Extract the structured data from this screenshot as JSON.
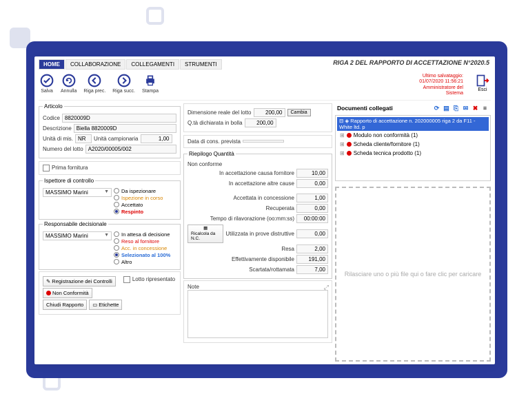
{
  "tabs": {
    "home": "HOME",
    "collab": "COLLABORAZIONE",
    "colleg": "COLLEGAMENTI",
    "strum": "STRUMENTI"
  },
  "title": "RIGA 2 DEL RAPPORTO DI ACCETTAZIONE N°2020.5",
  "toolbar": {
    "salva": "Salva",
    "annulla": "Annulla",
    "riga_prec": "Riga prec.",
    "riga_succ": "Riga succ.",
    "stampa": "Stampa",
    "esci": "Esci"
  },
  "saveinfo": {
    "line1": "Ultimo salvataggio:",
    "line2": "01/07/2020 11:56:21",
    "line3": "Amministratore del",
    "line4": "Sistema"
  },
  "articolo": {
    "legend": "Articolo",
    "codice_lbl": "Codice",
    "codice": "8820009D",
    "descr_lbl": "Descrizione",
    "descr": "Biella 8820009D",
    "um_lbl": "Unità di mis.",
    "um": "NR",
    "ucamp_lbl": "Unità campionaria",
    "ucamp": "1,00",
    "lotto_lbl": "Numero del lotto",
    "lotto": "A2020/00005/002",
    "prima_lbl": "Prima fornitura"
  },
  "ispettore": {
    "legend": "Ispettore di controllo",
    "value": "MASSIMO Marini",
    "r1": "Da ispezionare",
    "r2": "Ispezione in corso",
    "r3": "Accettato",
    "r4": "Respinto"
  },
  "responsabile": {
    "legend": "Responsabile decisionale",
    "value": "MASSIMO Marini",
    "r1": "In attesa di decisione",
    "r2": "Reso al fornitore",
    "r3": "Acc. in concessione",
    "r4": "Selezionato al 100%",
    "r5": "Altro"
  },
  "buttons": {
    "registrazione": "Registrazione dei Controlli",
    "nonconf": "Non Conformità",
    "chiudi": "Chiudi Rapporto",
    "etichette": "Etichette",
    "lotto_ripr": "Lotto ripresentato"
  },
  "dimens": {
    "dim_lbl": "Dimensione reale del lotto",
    "dim": "200,00",
    "cambia": "Cambia",
    "qta_lbl": "Q.tà dichiarata in bolla",
    "qta": "200,00",
    "data_lbl": "Data di cons. prevista",
    "data": ""
  },
  "riepilogo": {
    "legend": "Riepilogo Quantità",
    "nonconf_lbl": "Non conforme",
    "acc_forn_lbl": "In accettazione causa fornitore",
    "acc_forn": "10,00",
    "acc_altre_lbl": "In accettazione altre cause",
    "acc_altre": "0,00",
    "acc_conc_lbl": "Accettata in concessione",
    "acc_conc": "1,00",
    "recup_lbl": "Recuperata",
    "recup": "0,00",
    "tempo_lbl": "Tempo di rilavorazione (oo:mm:ss)",
    "tempo": "00:00:00",
    "ricalc_lbl": "Ricalcola da N.C.",
    "distr_lbl": "Utilizzata in prove distruttive",
    "distr": "0,00",
    "resa_lbl": "Resa",
    "resa": "2,00",
    "disp_lbl": "Effettivamente disponibile",
    "disp": "191,00",
    "scart_lbl": "Scartata/rottamata",
    "scart": "7,00"
  },
  "note_lbl": "Note",
  "docs": {
    "title": "Documenti collegati",
    "root": "Rapporto di accettazione n. 202000005 riga 2 da F11 - White ltd. p",
    "i1": "Modulo non conformità (1)",
    "i2": "Scheda cliente/fornitore (1)",
    "i3": "Scheda tecnica prodotto (1)",
    "drop": "Rilasciare uno o più file qui o fare clic per caricare"
  }
}
